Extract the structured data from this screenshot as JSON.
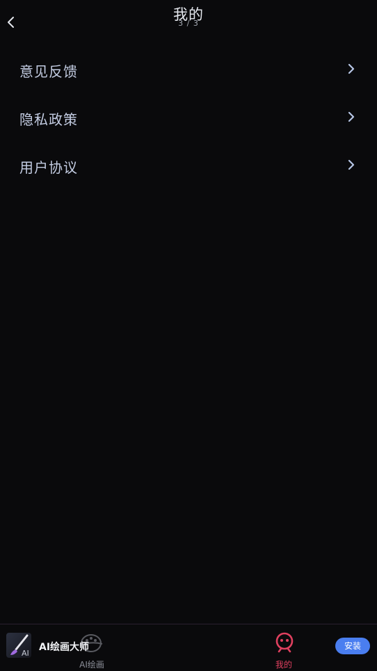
{
  "header": {
    "title": "我的",
    "page_indicator": "3 / 3"
  },
  "menu": {
    "items": [
      {
        "label": "意见反馈",
        "icon": "chevron-right-icon"
      },
      {
        "label": "隐私政策",
        "icon": "chevron-right-icon"
      },
      {
        "label": "用户协议",
        "icon": "chevron-right-icon"
      }
    ]
  },
  "bottom_nav": {
    "ad_title": "AI绘画大师",
    "install_label": "安装",
    "tabs": [
      {
        "label": "AI绘画",
        "icon": "palette-icon",
        "active": false
      },
      {
        "label": "我的",
        "icon": "robot-face-icon",
        "active": true
      }
    ]
  },
  "colors": {
    "background": "#0a0a0c",
    "accent": "#e0405f",
    "install_button": "#4a7ef0"
  }
}
